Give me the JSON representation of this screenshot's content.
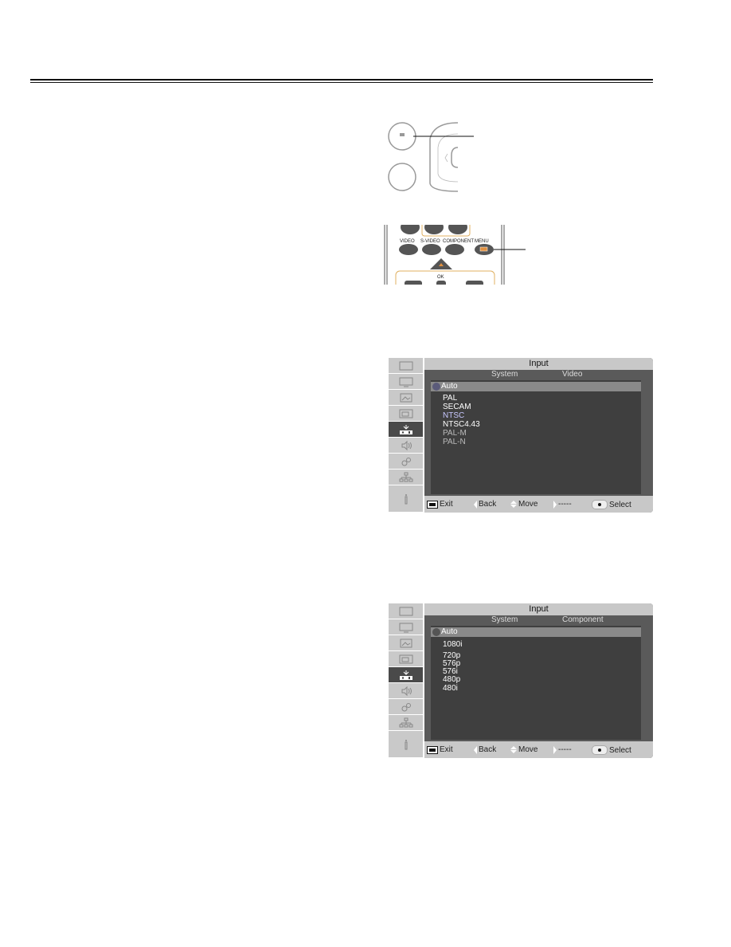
{
  "page": {
    "header_rule": "double-line"
  },
  "remote_illustrations": [
    {
      "name": "projector-control-panel",
      "callout_button": "MENU button (panel)"
    },
    {
      "name": "remote-control",
      "button_labels": [
        "VIDEO",
        "S-VIDEO",
        "COMPONENT",
        "MENU"
      ],
      "ok_label": "OK",
      "callout_button": "MENU"
    }
  ],
  "menus": [
    {
      "title": "Input",
      "header_system": "System",
      "header_type": "Video",
      "auto_label": "Auto",
      "options": [
        {
          "label": "PAL",
          "state": "normal"
        },
        {
          "label": "SECAM",
          "state": "normal"
        },
        {
          "label": "NTSC",
          "state": "highlight"
        },
        {
          "label": "NTSC4.43",
          "state": "normal"
        },
        {
          "label": "PAL-M",
          "state": "dim"
        },
        {
          "label": "PAL-N",
          "state": "dim"
        }
      ],
      "footer": {
        "exit": "Exit",
        "back": "Back",
        "move": "Move",
        "next": "-----",
        "select": "Select"
      }
    },
    {
      "title": "Input",
      "header_system": "System",
      "header_type": "Component",
      "auto_label": "Auto",
      "options": [
        {
          "label": "1080i",
          "state": "normal"
        },
        {
          "label": "720p",
          "state": "normal"
        },
        {
          "label": "576p",
          "state": "normal"
        },
        {
          "label": "576i",
          "state": "normal"
        },
        {
          "label": "480p",
          "state": "normal"
        },
        {
          "label": "480i",
          "state": "normal"
        }
      ],
      "footer": {
        "exit": "Exit",
        "back": "Back",
        "move": "Move",
        "next": "-----",
        "select": "Select"
      }
    }
  ],
  "sidebar_icons": [
    "display-icon",
    "pc-adjust-icon",
    "image-select-icon",
    "image-adjust-icon",
    "input-icon",
    "sound-icon",
    "setting-icon",
    "network-icon",
    "information-icon"
  ],
  "selected_sidebar_index": 4
}
